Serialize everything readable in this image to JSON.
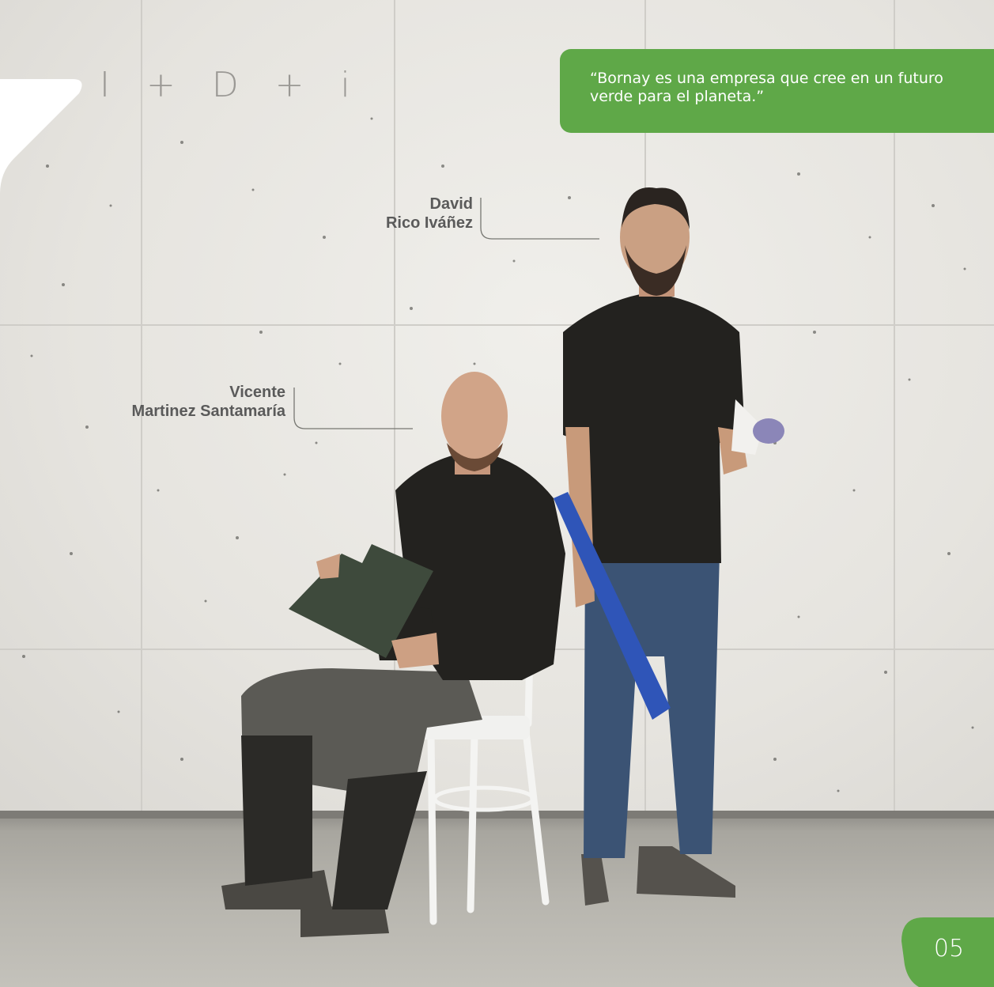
{
  "header": {
    "section_title": "I + D + i"
  },
  "quote": {
    "text": "“Bornay es una empresa que cree en un futuro verde para el planeta.”"
  },
  "people": [
    {
      "first_line": "David",
      "second_line": "Rico Iváñez"
    },
    {
      "first_line": "Vicente",
      "second_line": "Martinez Santamaría"
    }
  ],
  "footer": {
    "page_number": "05"
  },
  "colors": {
    "brand_green": "#5fa848",
    "title_gray": "#9a9894",
    "name_gray": "#5a5a5a"
  }
}
